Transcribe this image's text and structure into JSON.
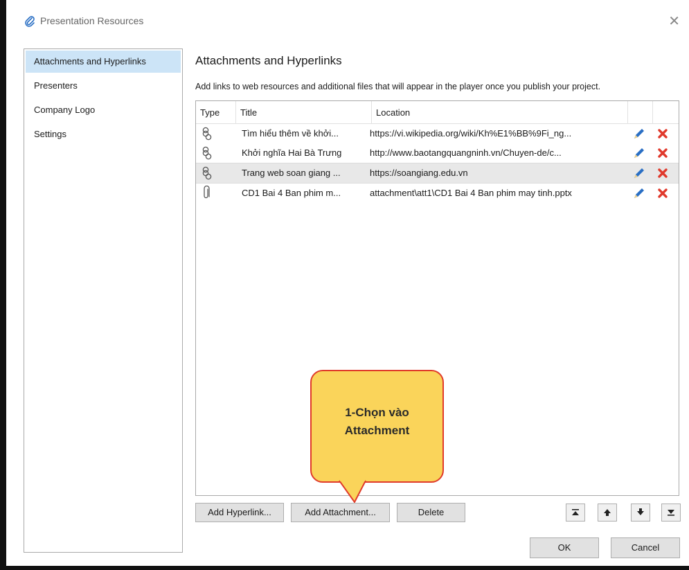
{
  "window": {
    "title": "Presentation Resources",
    "close_glyph": "✕",
    "icon": "paperclip-icon"
  },
  "sidebar": {
    "items": [
      {
        "label": "Attachments and Hyperlinks"
      },
      {
        "label": "Presenters"
      },
      {
        "label": "Company Logo"
      },
      {
        "label": "Settings"
      }
    ]
  },
  "main": {
    "heading": "Attachments and Hyperlinks",
    "description": "Add links to web resources and additional files that will appear in the player once you publish your project.",
    "columns": {
      "type": "Type",
      "title": "Title",
      "location": "Location"
    },
    "rows": [
      {
        "type_icon": "hyperlink-icon",
        "title": "Tìm hiểu thêm về khởi...",
        "location": "https://vi.wikipedia.org/wiki/Kh%E1%BB%9Fi_ng..."
      },
      {
        "type_icon": "hyperlink-icon",
        "title": "Khởi nghĩa Hai Bà Trưng",
        "location": "http://www.baotangquangninh.vn/Chuyen-de/c..."
      },
      {
        "type_icon": "hyperlink-icon",
        "title": "Trang web soan giang ...",
        "location": "https://soangiang.edu.vn"
      },
      {
        "type_icon": "attachment-icon",
        "title": "CD1 Bai 4 Ban phim m...",
        "location": "attachment\\att1\\CD1 Bai 4 Ban phim may tinh.pptx"
      }
    ]
  },
  "buttons": {
    "add_hyperlink": "Add Hyperlink...",
    "add_attachment": "Add Attachment...",
    "delete": "Delete",
    "ok": "OK",
    "cancel": "Cancel"
  },
  "callout": {
    "line1": "1-Chọn vào",
    "line2": "Attachment"
  },
  "colors": {
    "selected_sidebar": "#cce4f7",
    "edit_icon": "#2a6fc4",
    "delete_icon": "#e0392c",
    "callout_fill": "#fad45a",
    "callout_border": "#e03a2a"
  }
}
